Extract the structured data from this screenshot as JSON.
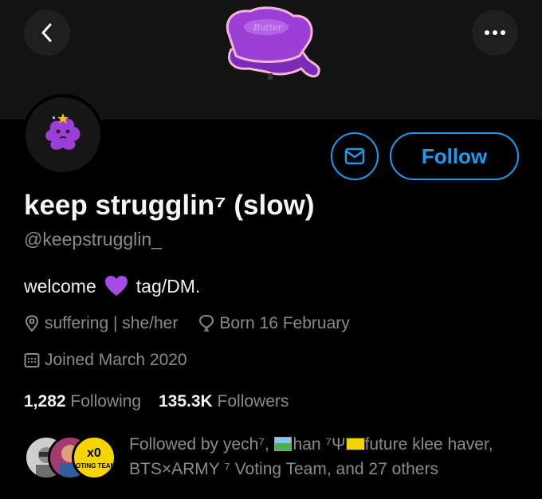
{
  "profile": {
    "display_name": "keep strugglin⁷ (slow)",
    "handle": "@keepstrugglin_",
    "bio_before": "welcome",
    "bio_emoji": "purple-heart",
    "bio_after": "tag/DM.",
    "location": "suffering | she/her",
    "birthday": "Born 16 February",
    "joined": "Joined March 2020"
  },
  "stats": {
    "following_count": "1,282",
    "following_label": "Following",
    "followers_count": "135.3K",
    "followers_label": "Followers"
  },
  "actions": {
    "follow_label": "Follow",
    "message_icon": "mail-icon",
    "back_icon": "chevron-left-icon",
    "more_icon": "more-horizontal-icon"
  },
  "followed_by": {
    "prefix": "Followed by yech⁷,",
    "name2": "han ⁷Ψ",
    "name3": "future klee haver,",
    "rest": "BTS×ARMY ⁷ Voting Team, and 27 others",
    "avatar3_text_top": "x0",
    "avatar3_text_bottom": "OTING TEAM"
  },
  "banner": {
    "sticker_text": "Butter"
  },
  "colors": {
    "accent": "#1d9bf0",
    "background": "#000000",
    "secondary_text": "#8b8b8b",
    "banner": "#131313",
    "purple": "#9b3fd6"
  }
}
